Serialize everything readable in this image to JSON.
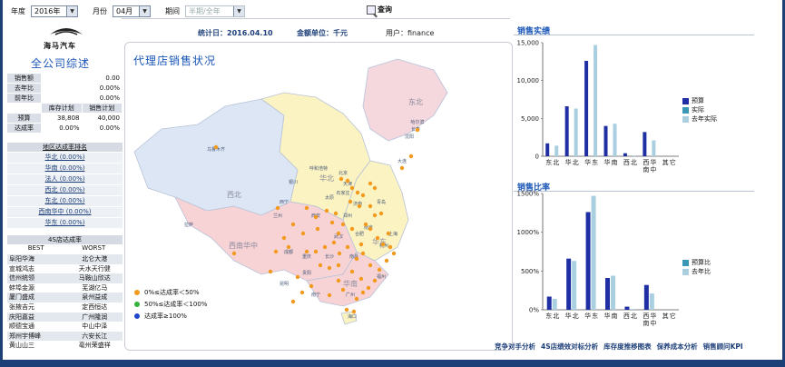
{
  "filters": {
    "year_label": "年度",
    "year_value": "2016年",
    "month_label": "月份",
    "month_value": "04月",
    "period_label": "期间",
    "period_value": "半期/全年",
    "query_label": "查询"
  },
  "info": {
    "date_text": "统计日：2016.04.10",
    "unit_text": "金额单位：千元",
    "user_text": "用户：finance"
  },
  "company": {
    "logo_text": "海马汽车",
    "title": "全公司综述"
  },
  "kpi": {
    "sales_label": "销售额",
    "sales_value": "0.00",
    "yoy_label": "去年比",
    "yoy_value": "0.00%",
    "mom_label": "前年比",
    "mom_value": "0.00%",
    "col_inventory": "库存计划",
    "col_sales": "销售计划",
    "budget_label": "预算",
    "budget_inventory": "38,808",
    "budget_sales": "40,000",
    "rate_label": "达成率",
    "rate_inventory": "0.00%",
    "rate_sales": "0.00%"
  },
  "region_ranking": {
    "title": "地区达成率排名",
    "items": [
      "华北 (0.00%)",
      "华南 (0.00%)",
      "法人 (0.00%)",
      "西北 (0.00%)",
      "东北 (0.00%)",
      "西南华中 (0.00%)",
      "华东 (0.00%)"
    ]
  },
  "store_ranking": {
    "title": "4S店达成率",
    "best_label": "BEST",
    "worst_label": "WORST",
    "rows": [
      [
        "阜阳华海",
        "北仑大港"
      ],
      [
        "宣城鸿志",
        "天水天行健"
      ],
      [
        "信州统领",
        "马鞍山欣达"
      ],
      [
        "蚌埠金源",
        "芜湖亿马"
      ],
      [
        "厦门盛成",
        "泉州益成"
      ],
      [
        "张掖吉元",
        "定西恒达"
      ],
      [
        "庆阳嘉益",
        "广州隆润"
      ],
      [
        "顺德宝通",
        "中山中泽"
      ],
      [
        "郑州宇博峰",
        "六安长江"
      ],
      [
        "黄山山三",
        "亳州荣盛祥"
      ]
    ]
  },
  "map": {
    "title": "代理店销售状况",
    "legend": [
      {
        "label": "0%≤达成率＜50%",
        "color": "#f39a1e"
      },
      {
        "label": "50%≤达成率＜100%",
        "color": "#33b33a"
      },
      {
        "label": "达成率≥100%",
        "color": "#1f47c9"
      }
    ],
    "region_labels": [
      "西北",
      "东北",
      "华北",
      "西南华中",
      "华东",
      "华南"
    ],
    "city_labels": [
      "乌鲁木齐",
      "哈尔滨",
      "长春",
      "沈阳",
      "大连",
      "呼和浩特",
      "北京",
      "天津",
      "太原",
      "石家庄",
      "济南",
      "青岛",
      "银川",
      "西宁",
      "兰州",
      "西安",
      "郑州",
      "南京",
      "合肥",
      "上海",
      "杭州",
      "武汉",
      "成都",
      "重庆",
      "长沙",
      "南昌",
      "福州",
      "贵阳",
      "昆明",
      "南宁",
      "广州",
      "海口",
      "拉萨"
    ]
  },
  "sales_chart": {
    "title": "销售实绩",
    "chart_data": {
      "type": "bar",
      "categories": [
        "东北",
        "华北",
        "华东",
        "华南",
        "西北",
        "西南华中",
        "其它"
      ],
      "series": [
        {
          "name": "预算",
          "color": "#1f2fa3",
          "values": [
            1700,
            6600,
            12600,
            4000,
            400,
            3200,
            0
          ]
        },
        {
          "name": "实际",
          "color": "#3b97b6",
          "values": [
            0,
            0,
            0,
            0,
            0,
            0,
            0
          ]
        },
        {
          "name": "去年实际",
          "color": "#a9cfe0",
          "values": [
            1400,
            6300,
            14700,
            4300,
            100,
            2100,
            0
          ]
        }
      ],
      "ylim": [
        0,
        15000
      ],
      "yticks": [
        "0",
        "5,000",
        "10,000",
        "15,000"
      ]
    }
  },
  "ratio_chart": {
    "title": "销售比率",
    "chart_data": {
      "type": "bar",
      "categories": [
        "东北",
        "华北",
        "华东",
        "华南",
        "西北",
        "西南华中",
        "其它"
      ],
      "series": [
        {
          "name": "预算比",
          "color": "#1f2fa3",
          "values": [
            170,
            660,
            1260,
            410,
            40,
            320,
            0
          ]
        },
        {
          "name": "去年比",
          "color": "#a9cfe0",
          "values": [
            140,
            630,
            1470,
            440,
            10,
            210,
            0
          ]
        }
      ],
      "legend_colors": [
        "#3b97b6",
        "#a9cfe0"
      ],
      "ylim": [
        0,
        1500
      ],
      "yticks": [
        "0%",
        "500%",
        "1000%",
        "1500%"
      ]
    }
  },
  "bottom_links": [
    "竞争对手分析",
    "4S店绩效对标分析",
    "库存度推移图表",
    "保养成本分析",
    "销售顾问KPI"
  ]
}
